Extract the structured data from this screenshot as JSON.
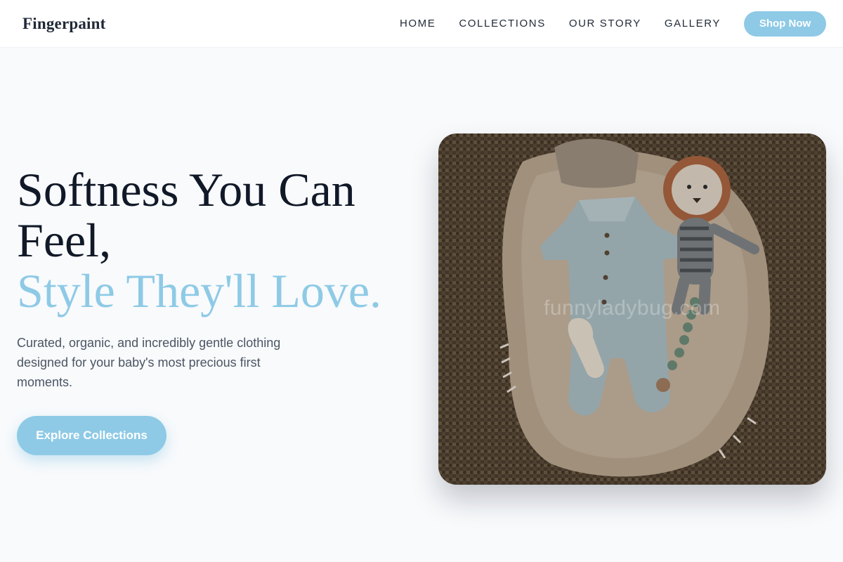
{
  "brand": {
    "name": "Fingerpaint"
  },
  "nav": {
    "items": [
      {
        "label": "HOME"
      },
      {
        "label": "COLLECTIONS"
      },
      {
        "label": "OUR STORY"
      },
      {
        "label": "GALLERY"
      }
    ],
    "cta_label": "Shop Now"
  },
  "hero": {
    "headline_line1": "Softness You Can Feel,",
    "headline_accent": "Style They'll Love.",
    "subtext": "Curated, organic, and incredibly gentle clothing designed for your baby's most precious first moments.",
    "cta_label": "Explore Collections",
    "image": {
      "description_icon": "baby-clothes-photo",
      "watermark": "funnyladybug.com"
    }
  },
  "colors": {
    "accent": "#8ecae6",
    "headline": "#111827",
    "body_text": "#4b5563",
    "background": "#f8fafc"
  }
}
